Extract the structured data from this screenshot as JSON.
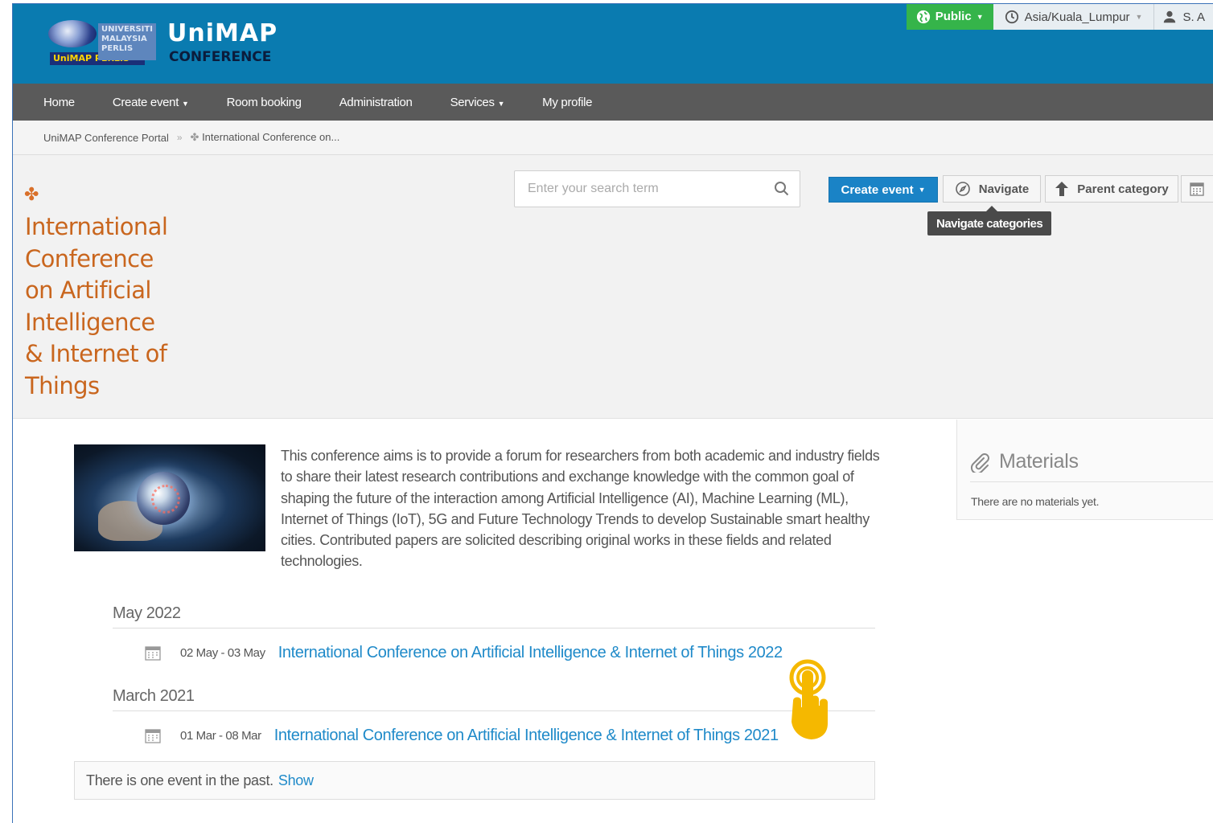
{
  "header": {
    "logo_title": "UniMAP",
    "logo_subtitle": "CONFERENCE",
    "logo_university": "UNIVERSITI MALAYSIA PERLIS",
    "logo_emblem_text": "UniMAP PERLIS",
    "visibility_label": "Public",
    "timezone_label": "Asia/Kuala_Lumpur",
    "user_label": "S. A"
  },
  "nav": {
    "items": [
      {
        "label": "Home",
        "has_caret": false
      },
      {
        "label": "Create event",
        "has_caret": true
      },
      {
        "label": "Room booking",
        "has_caret": false
      },
      {
        "label": "Administration",
        "has_caret": false
      },
      {
        "label": "Services",
        "has_caret": true
      },
      {
        "label": "My profile",
        "has_caret": false
      }
    ]
  },
  "breadcrumb": {
    "root": "UniMAP Conference Portal",
    "separator": "»",
    "current": "International Conference on..."
  },
  "category": {
    "title": "International Conference on Artificial Intelligence & Internet of Things",
    "title_lines": [
      "International",
      "Conference",
      "on Artificial",
      "Intelligence",
      "& Internet of",
      "Things"
    ]
  },
  "search": {
    "placeholder": "Enter your search term"
  },
  "toolbar": {
    "create_event": "Create event",
    "navigate": "Navigate",
    "parent_category": "Parent category",
    "tooltip": "Navigate categories"
  },
  "description": "This conference aims is to provide a forum for researchers from both academic and industry fields to share their latest research contributions and exchange knowledge with the common goal of shaping the future of the interaction among Artificial Intelligence (AI), Machine Learning (ML), Internet of Things (IoT), 5G and Future Technology Trends to develop Sustainable smart healthy cities. Contributed papers are solicited describing original works in these fields and related technologies.",
  "events": [
    {
      "month": "May 2022",
      "date": "02 May - 03 May",
      "title": "International Conference on Artificial Intelligence & Internet of Things 2022"
    },
    {
      "month": "March 2021",
      "date": "01 Mar - 08 Mar",
      "title": "International Conference on Artificial Intelligence & Internet of Things 2021"
    }
  ],
  "past": {
    "text": "There is one event in the past.",
    "link": "Show"
  },
  "materials": {
    "title": "Materials",
    "empty_text": "There are no materials yet."
  },
  "colors": {
    "header_bg": "#0a7bb0",
    "nav_bg": "#5a5a5a",
    "accent_orange": "#c9661e",
    "link_blue": "#1f8ac9",
    "public_green": "#35b44a",
    "button_blue": "#1a83c6",
    "pointer_yellow": "#f5b800"
  }
}
